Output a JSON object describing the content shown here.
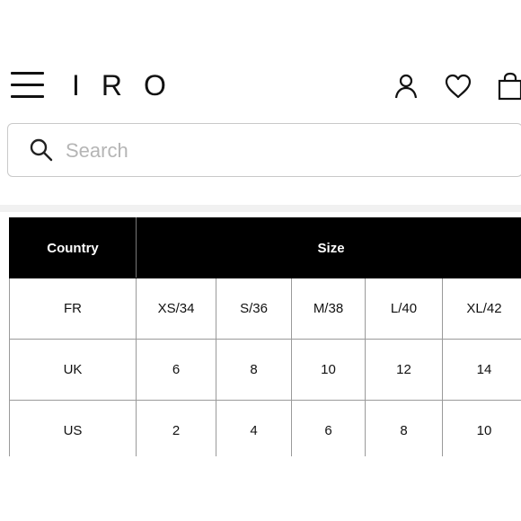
{
  "header": {
    "menu_icon": "hamburger-menu-icon",
    "logo": "IRO",
    "icons": [
      "account-icon",
      "heart-icon",
      "shopping-bag-icon"
    ]
  },
  "search": {
    "placeholder": "Search",
    "value": "",
    "icon": "search-icon"
  },
  "size_table": {
    "headers": {
      "country": "Country",
      "size": "Size"
    },
    "rows": [
      {
        "country": "FR",
        "sizes": [
          "XS/34",
          "S/36",
          "M/38",
          "L/40",
          "XL/42"
        ]
      },
      {
        "country": "UK",
        "sizes": [
          "6",
          "8",
          "10",
          "12",
          "14"
        ]
      },
      {
        "country": "US",
        "sizes": [
          "2",
          "4",
          "6",
          "8",
          "10"
        ]
      }
    ]
  },
  "colors": {
    "header_bg": "#000000",
    "header_text": "#ffffff",
    "border": "#9a9a9a",
    "placeholder": "#b5b5b5"
  }
}
